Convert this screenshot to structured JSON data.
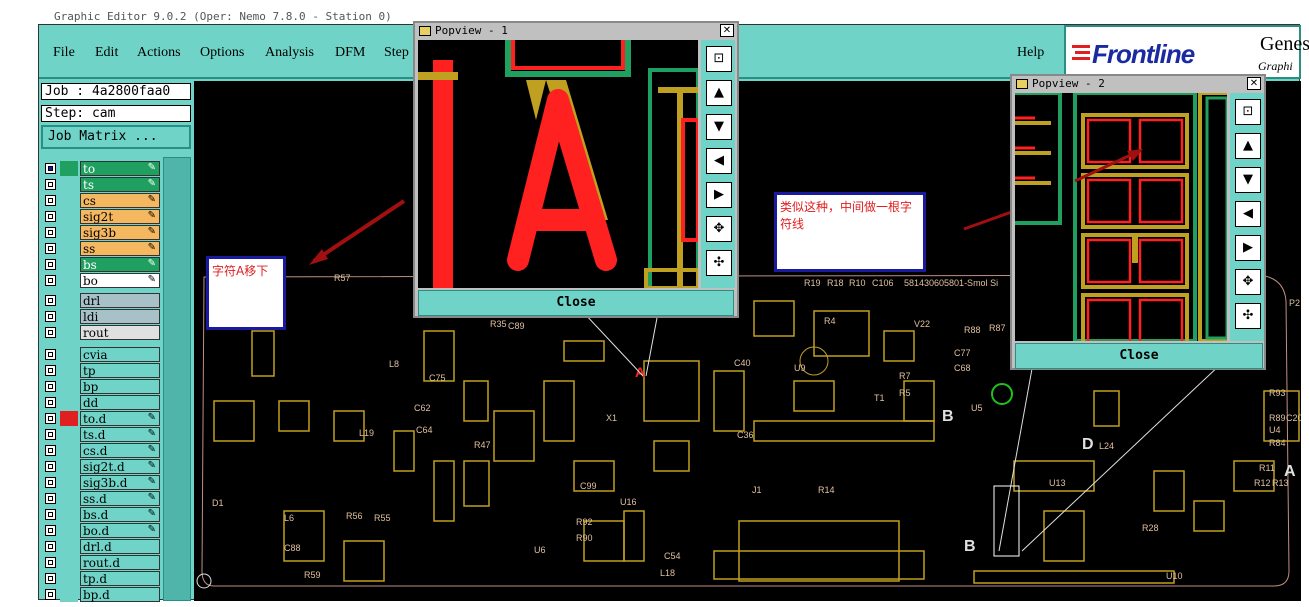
{
  "window": {
    "title": "Graphic Editor 9.0.2 (Oper: Nemo 7.8.0 - Station 0)"
  },
  "menu": [
    "File",
    "Edit",
    "Actions",
    "Options",
    "Analysis",
    "DFM",
    "Step"
  ],
  "menu_help": "Help",
  "logo": {
    "brand": "Frontline",
    "genesis": "Genes",
    "graphic": "Graphi"
  },
  "job": {
    "job_label": "Job : 4a2800faa0",
    "step_label": "Step: cam",
    "matrix_button": "Job Matrix ..."
  },
  "layers_board": [
    {
      "name": "to",
      "color": "#20a060",
      "edit": true
    },
    {
      "name": "ts",
      "color": "#20a060",
      "edit": true
    },
    {
      "name": "cs",
      "color": "#f5b860",
      "edit": true
    },
    {
      "name": "sig2t",
      "color": "#f5b860",
      "edit": true
    },
    {
      "name": "sig3b",
      "color": "#f5b860",
      "edit": true
    },
    {
      "name": "ss",
      "color": "#f5b860",
      "edit": true
    },
    {
      "name": "bs",
      "color": "#20a060",
      "edit": true
    },
    {
      "name": "bo",
      "color": "#ffffff",
      "edit": true
    }
  ],
  "layers_drill": [
    {
      "name": "drl",
      "color": "#a8c0c8"
    },
    {
      "name": "ldi",
      "color": "#a8c0c8"
    },
    {
      "name": "rout",
      "color": "#e0e0e0"
    }
  ],
  "layers_misc": [
    {
      "name": "cvia",
      "edit": false
    },
    {
      "name": "tp",
      "edit": false
    },
    {
      "name": "bp",
      "edit": false
    },
    {
      "name": "dd",
      "edit": false
    },
    {
      "name": "to.d",
      "edit": true,
      "flag": "#e02020"
    },
    {
      "name": "ts.d",
      "edit": true
    },
    {
      "name": "cs.d",
      "edit": true
    },
    {
      "name": "sig2t.d",
      "edit": true
    },
    {
      "name": "sig3b.d",
      "edit": true
    },
    {
      "name": "ss.d",
      "edit": true
    },
    {
      "name": "bs.d",
      "edit": true
    },
    {
      "name": "bo.d",
      "edit": true
    },
    {
      "name": "drl.d",
      "edit": false
    },
    {
      "name": "rout.d",
      "edit": false
    },
    {
      "name": "tp.d",
      "edit": false
    },
    {
      "name": "bp.d",
      "edit": false
    }
  ],
  "popview1": {
    "title": "Popview - 1",
    "close_label": "Close",
    "close_x": "✕",
    "glyph": "A"
  },
  "popview2": {
    "title": "Popview - 2",
    "close_label": "Close",
    "close_x": "✕"
  },
  "notes": {
    "note_a": "字符A移下",
    "note_b": "类似这种，中间做一根字符线"
  },
  "board_labels": {
    "r57": "R57",
    "r35": "R35",
    "c89": "C89",
    "r19": "R19",
    "r18": "R18",
    "r10": "R10",
    "c106": "C106",
    "part": "581430605801-Smol Si",
    "v22": "V22",
    "r88": "R88",
    "r87": "R87",
    "r3": "R3",
    "r4": "R4",
    "l8": "L8",
    "c75": "C75",
    "c62": "C62",
    "c64": "C64",
    "l19": "L19",
    "c40": "C40",
    "u9": "U9",
    "c77": "C77",
    "c68": "C68",
    "r7": "R7",
    "r5": "R5",
    "t1": "T1",
    "u5": "U5",
    "b": "B",
    "c36": "C36",
    "r14": "R14",
    "j1": "J1",
    "u16": "U16",
    "r92": "R92",
    "r90": "R90",
    "c54": "C54",
    "l18": "L18",
    "u6": "U6",
    "r59": "R59",
    "d1": "D1",
    "l24": "L24",
    "u13": "U13",
    "a": "A",
    "r28": "R28",
    "r12": "R12",
    "r13": "R13",
    "u10": "U10",
    "p2": "P2",
    "r47": "R47",
    "c99": "C99",
    "l6": "L6",
    "r56": "R56",
    "r55": "R55",
    "c88": "C88",
    "x1": "X1",
    "r93": "R93",
    "r89": "R89",
    "c20": "C20",
    "u4": "U4",
    "r11": "R11",
    "r84": "R84",
    "b2": "B",
    "d": "D"
  },
  "colors": {
    "app_bg": "#6fd3c7",
    "canvas": "#000000",
    "pad_yellow": "#c0a020",
    "pad_red": "#ff2020",
    "green": "#20a060",
    "note_border": "#1a1aa0",
    "arrow": "#a01010"
  }
}
